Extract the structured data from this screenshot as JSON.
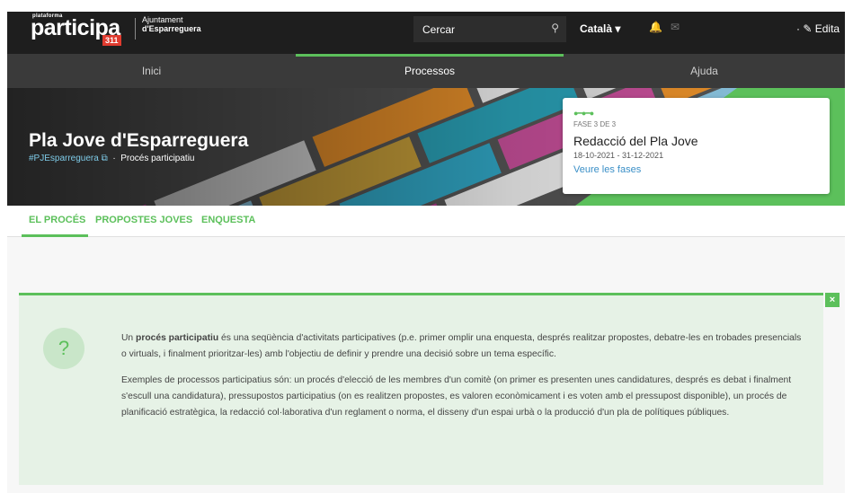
{
  "header": {
    "logo_top": "plataforma",
    "logo_main": "participa",
    "logo_num": "311",
    "org_line1": "Ajuntament",
    "org_line2": "d'Esparreguera",
    "search_placeholder": "Cercar",
    "language": "Català ▾",
    "edit_label": "Edita"
  },
  "nav": {
    "tabs": [
      "Inici",
      "Processos",
      "Ajuda"
    ],
    "active": "Processos"
  },
  "hero": {
    "title": "Pla Jove d'Esparreguera",
    "hashtag": "#PJEsparreguera",
    "separator": "·",
    "type": "Procés participatiu",
    "phase": {
      "step": "FASE 3 DE 3",
      "name": "Redacció del Pla Jove",
      "dates": "18-10-2021 - 31-12-2021",
      "link": "Veure les fases"
    }
  },
  "subtabs": [
    "EL PROCÉS",
    "PROPOSTES JOVES",
    "ENQUESTA"
  ],
  "callout": {
    "p1_pre": "Un ",
    "p1_bold": "procés participatiu",
    "p1_post": " és una seqüència d'activitats participatives (p.e. primer omplir una enquesta, després realitzar propostes, debatre-les en trobades presencials o virtuals, i finalment prioritzar-les) amb l'objectiu de definir y prendre una decisió sobre un tema específic.",
    "p2": "Exemples de processos participatius són: un procés d'elecció de les membres d'un comitè (on primer es presenten unes candidatures, després es debat i finalment s'escull una candidatura), pressupostos participatius (on es realitzen propostes, es valoren econòmicament i es voten amb el pressupost disponible), un procés de planificació estratègica, la redacció col·laborativa d'un reglament o norma, el disseny d'un espai urbà o la producció d'un pla de polítiques públiques."
  },
  "colors": {
    "accent": "#5cc05b",
    "header": "#1e1e1e",
    "nav": "#3a3a3a",
    "link": "#3a8fc7"
  }
}
